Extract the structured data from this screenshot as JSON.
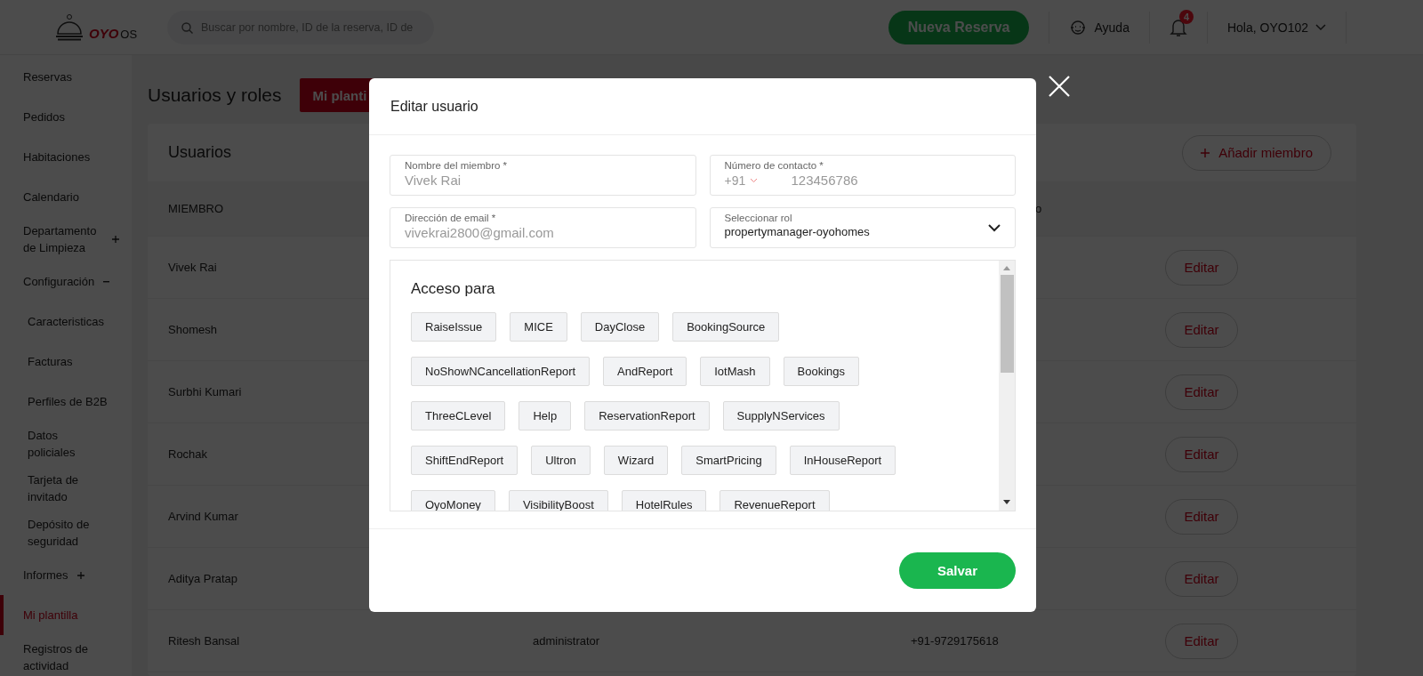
{
  "header": {
    "logo": {
      "brand": "OYO",
      "suffix": "OS"
    },
    "search": {
      "placeholder": "Buscar por nombre, ID de la reserva, ID de"
    },
    "new_booking": "Nueva Reserva",
    "help": "Ayuda",
    "notifications": {
      "badge": "4"
    },
    "user": "Hola, OYO102"
  },
  "sidebar": {
    "items": [
      {
        "label": "Reservas",
        "selected": false
      },
      {
        "label": "Pedidos",
        "selected": false
      },
      {
        "label": "Habitaciones",
        "selected": false
      },
      {
        "label": "Calendario",
        "selected": false
      },
      {
        "label": "Departamento de Limpieza",
        "selected": false,
        "expanded": false
      },
      {
        "label": "Configuración",
        "selected": false,
        "expanded": true,
        "children": [
          {
            "label": "Caracteristicas",
            "selected": false
          },
          {
            "label": "Facturas",
            "selected": false
          },
          {
            "label": "Perfiles de B2B",
            "selected": false
          },
          {
            "label": "Datos policiales",
            "selected": false
          },
          {
            "label": "Tarjeta de invitado",
            "selected": false
          },
          {
            "label": "Depósito de seguridad",
            "selected": false
          }
        ]
      },
      {
        "label": "Informes",
        "selected": false,
        "expanded": false
      },
      {
        "label": "Mi plantilla",
        "selected": true
      },
      {
        "label": "Registros de actividad",
        "selected": false
      }
    ]
  },
  "page": {
    "title": "Usuarios y roles",
    "tab": "Mi planti"
  },
  "users_card": {
    "title": "Usuarios",
    "add_button": "Añadir miembro",
    "columns": [
      "MIEMBRO",
      "o"
    ],
    "rows": [
      {
        "member": "Vivek Rai",
        "action": "Editar"
      },
      {
        "member": "Shomesh",
        "action": "Editar"
      },
      {
        "member": "Surbhi Kumari",
        "action": "Editar"
      },
      {
        "member": "Rochak",
        "action": "Editar"
      },
      {
        "member": "Arvind Kumar",
        "action": "Editar"
      },
      {
        "member": "Aditya Pratap",
        "action": "Editar"
      },
      {
        "member": "Ritesh Bansal",
        "role": "administrator",
        "phone": "+91-9729175618",
        "action": "Editar"
      }
    ]
  },
  "modal": {
    "title": "Editar usuario",
    "fields": [
      {
        "kind": "text",
        "label": "Nombre del miembro *",
        "value": "Vivek Rai",
        "disabled": true
      },
      {
        "kind": "phone",
        "label": "Número de contacto *",
        "code": "+91",
        "value": "123456786",
        "disabled": true
      },
      {
        "kind": "text",
        "label": "Dirección de email *",
        "value": "vivekrai2800@gmail.com",
        "disabled": true
      },
      {
        "kind": "select",
        "label": "Seleccionar rol",
        "value": "propertymanager-oyohomes",
        "disabled": false
      }
    ],
    "access": {
      "title": "Acceso para",
      "items": [
        "RaiseIssue",
        "MICE",
        "DayClose",
        "BookingSource",
        "NoShowNCancellationReport",
        "AndReport",
        "IotMash",
        "Bookings",
        "ThreeCLevel",
        "Help",
        "ReservationReport",
        "SupplyNServices",
        "ShiftEndReport",
        "Ultron",
        "Wizard",
        "SmartPricing",
        "InHouseReport",
        "OyoMoney",
        "VisibilityBoost",
        "HotelRules",
        "RevenueReport"
      ]
    },
    "save": "Salvar"
  }
}
